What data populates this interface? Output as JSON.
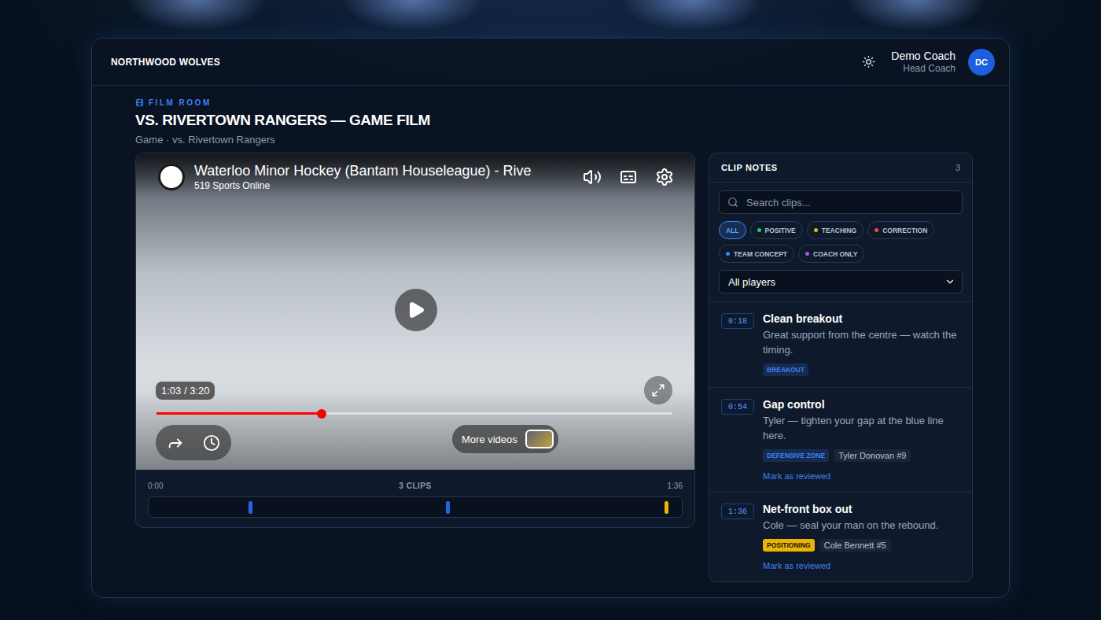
{
  "header": {
    "team": "NORTHWOOD WOLVES",
    "user": {
      "name": "Demo Coach",
      "role": "Head Coach",
      "initials": "DC"
    }
  },
  "page": {
    "section": "FILM ROOM",
    "title": "VS. RIVERTOWN RANGERS — GAME FILM",
    "subtitle": "Game · vs. Rivertown Rangers"
  },
  "player": {
    "title": "Waterloo Minor Hockey (Bantam Houseleague) - Rive",
    "channel": "519 Sports Online",
    "time": "1:03 / 3:20",
    "level": 0.32,
    "more": "More videos"
  },
  "timeline": {
    "start": "0:00",
    "count": "3 CLIPS",
    "end": "1:36",
    "markers": [
      {
        "level": 0.19,
        "color": "#2563eb"
      },
      {
        "level": 0.56,
        "color": "#2563eb"
      },
      {
        "level": 0.97,
        "color": "#eab308"
      }
    ]
  },
  "clip_notes": {
    "title": "CLIP NOTES",
    "count": "3",
    "search": {
      "placeholder": "Search clips..."
    },
    "filters": [
      {
        "label": "ALL",
        "selected": true
      },
      {
        "label": "POSITIVE",
        "selected": false,
        "color": "#22c55e"
      },
      {
        "label": "TEACHING",
        "selected": false,
        "color": "#eab308"
      },
      {
        "label": "CORRECTION",
        "selected": false,
        "color": "#ef4444"
      },
      {
        "label": "TEAM CONCEPT",
        "selected": false,
        "color": "#3b82f6"
      },
      {
        "label": "COACH ONLY",
        "selected": false,
        "color": "#a855f7"
      }
    ],
    "player_select": "All players",
    "clips": [
      {
        "time": "0:18",
        "title": "Clean breakout",
        "note": "Great support from the centre — watch the timing.",
        "tags": [
          {
            "label": "BREAKOUT",
            "color": "#3b82f6",
            "kind": "soft"
          }
        ],
        "reviewed": true
      },
      {
        "time": "0:54",
        "title": "Gap control",
        "note": "Tyler — tighten your gap at the blue line here.",
        "tags": [
          {
            "label": "DEFENSIVE ZONE",
            "color": "#3b82f6",
            "kind": "soft"
          }
        ],
        "player": "Tyler Donovan #9",
        "reviewed": false,
        "action": "Mark as reviewed"
      },
      {
        "time": "1:36",
        "title": "Net-front box out",
        "note": "Cole — seal your man on the rebound.",
        "tags": [
          {
            "label": "POSITIONING",
            "color": "#eab308",
            "kind": "solid"
          }
        ],
        "player": "Cole Bennett #5",
        "reviewed": false,
        "action": "Mark as reviewed"
      }
    ]
  }
}
